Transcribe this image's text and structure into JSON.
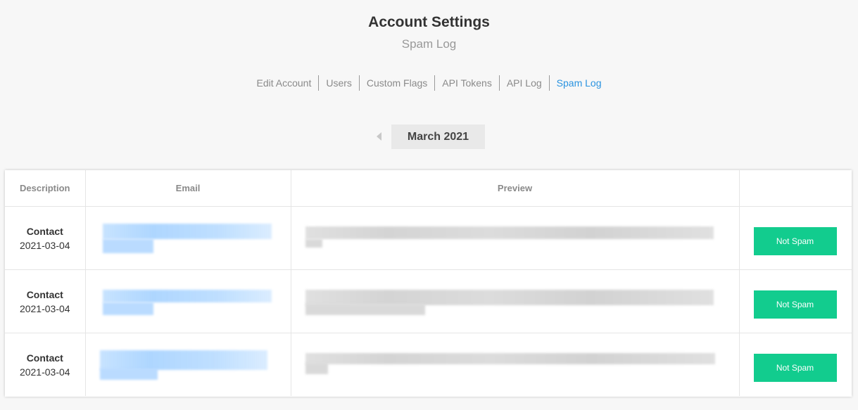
{
  "header": {
    "title": "Account Settings",
    "subtitle": "Spam Log"
  },
  "nav": {
    "items": [
      "Edit Account",
      "Users",
      "Custom Flags",
      "API Tokens",
      "API Log",
      "Spam Log"
    ],
    "active": "Spam Log"
  },
  "month": {
    "label": "March 2021"
  },
  "table": {
    "headers": [
      "Description",
      "Email",
      "Preview",
      ""
    ],
    "rows": [
      {
        "type": "Contact",
        "date": "2021-03-04",
        "action": "Not Spam"
      },
      {
        "type": "Contact",
        "date": "2021-03-04",
        "action": "Not Spam"
      },
      {
        "type": "Contact",
        "date": "2021-03-04",
        "action": "Not Spam"
      }
    ]
  },
  "colors": {
    "accent": "#2a93e0",
    "button": "#12cc8e"
  }
}
